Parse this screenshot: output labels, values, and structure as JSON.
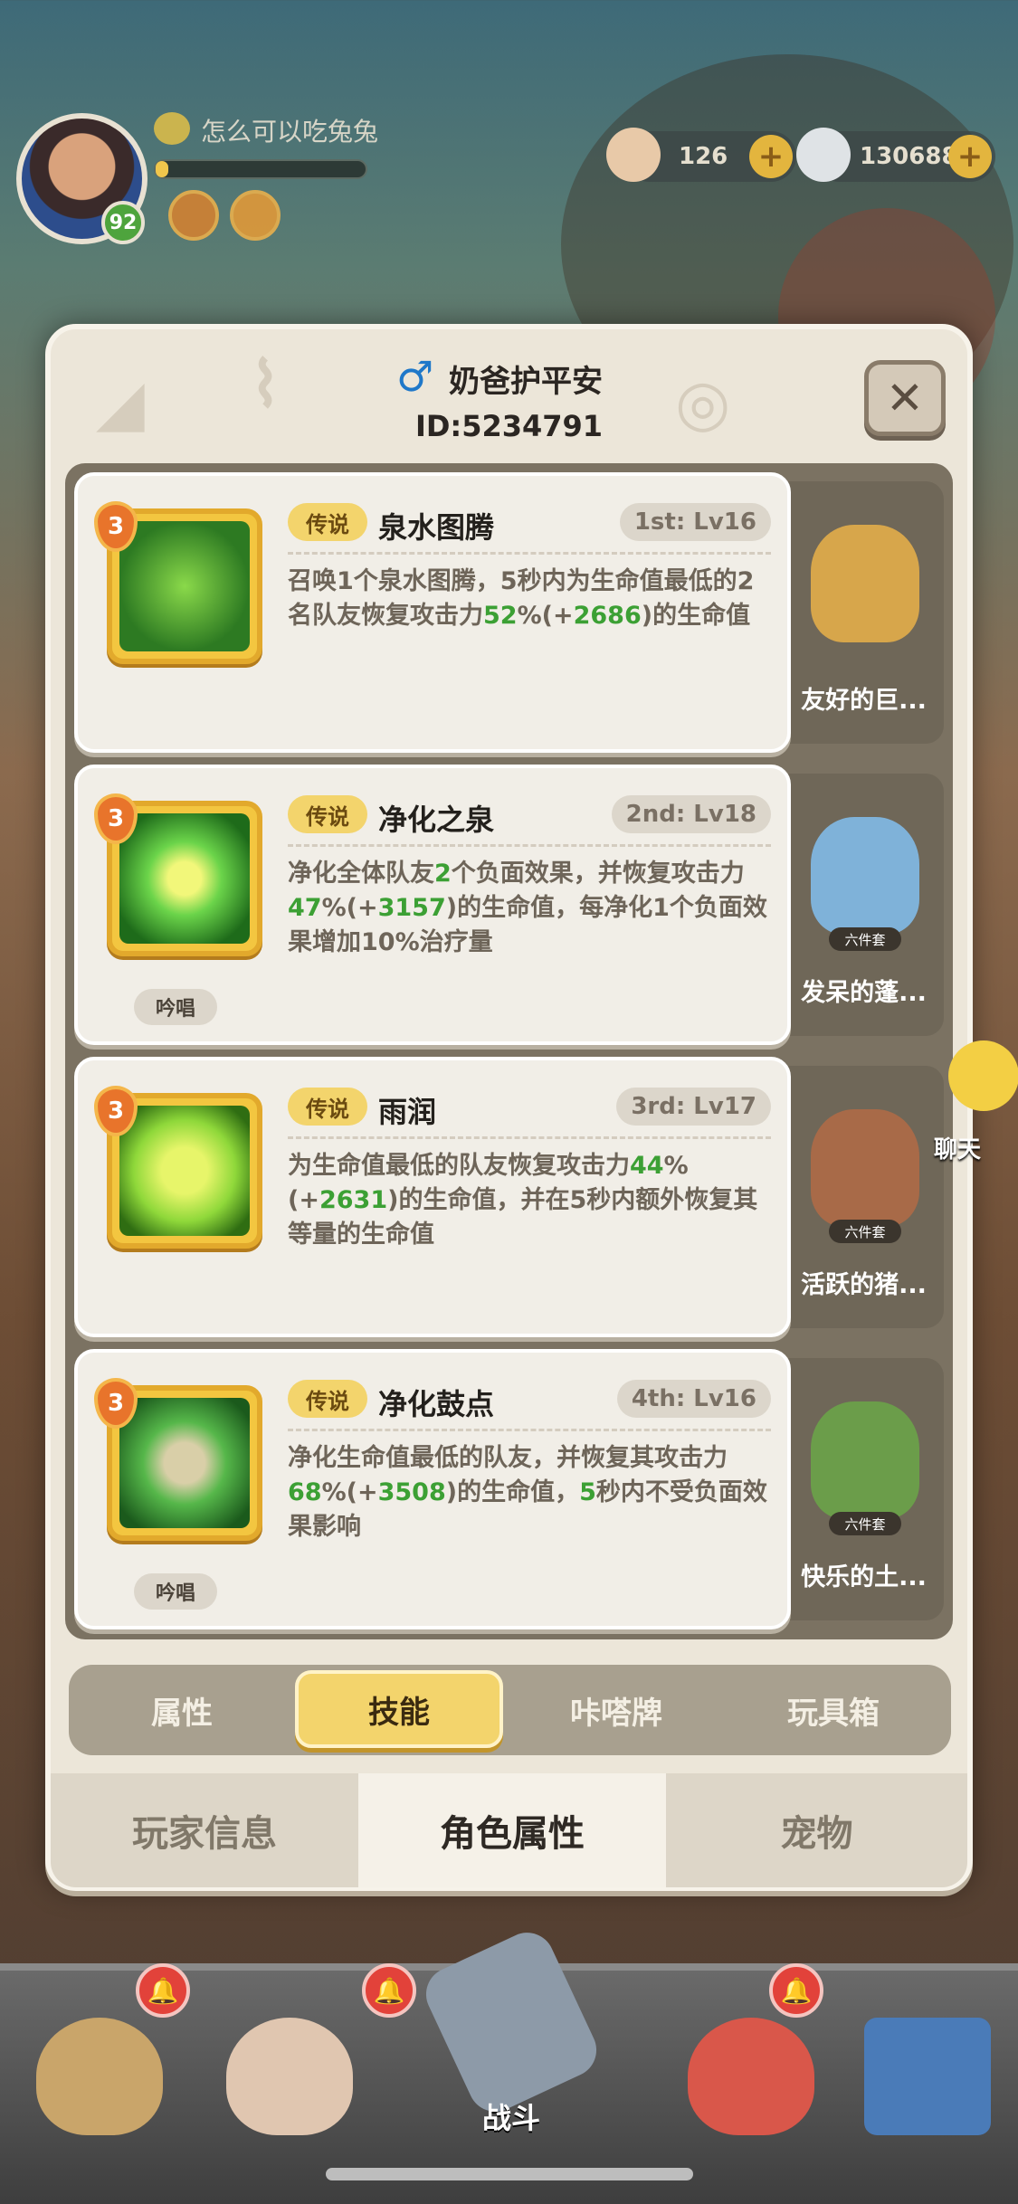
{
  "player": {
    "name": "怎么可以吃兔兔",
    "level": "92",
    "xp_fraction": 0.06
  },
  "currencies": [
    {
      "value": "126",
      "icon": "shell-coin-icon"
    },
    {
      "value": "130688",
      "icon": "pearl-icon"
    }
  ],
  "modal": {
    "gender_icon": "male-icon",
    "gender_glyph": "♂",
    "name": "奶爸护平安",
    "id": "ID:5234791",
    "close_glyph": "✕"
  },
  "skills": [
    {
      "rank": "3",
      "rarity": "传说",
      "name": "泉水图腾",
      "level": "1st: Lv16",
      "desc_parts": [
        "召唤1个泉水图腾，5秒内为生命值最低的2名队友恢复攻击力",
        "52",
        "%(+",
        "2686",
        ")的生命值"
      ],
      "chant": "",
      "set_tag": "",
      "set_name": "友好的巨..."
    },
    {
      "rank": "3",
      "rarity": "传说",
      "name": "净化之泉",
      "level": "2nd: Lv18",
      "desc_parts": [
        "净化全体队友",
        "2",
        "个负面效果，并恢复攻击力",
        "47",
        "%(+",
        "3157",
        ")的生命值，每净化1个负面效果增加10%治疗量"
      ],
      "chant": "吟唱",
      "set_tag": "六件套",
      "set_name": "发呆的蓬..."
    },
    {
      "rank": "3",
      "rarity": "传说",
      "name": "雨润",
      "level": "3rd: Lv17",
      "desc_parts": [
        "为生命值最低的队友恢复攻击力",
        "44",
        "%(+",
        "2631",
        ")的生命值，并在5秒内额外恢复其等量的生命值"
      ],
      "chant": "",
      "set_tag": "六件套",
      "set_name": "活跃的猪..."
    },
    {
      "rank": "3",
      "rarity": "传说",
      "name": "净化鼓点",
      "level": "4th: Lv16",
      "desc_parts": [
        "净化生命值最低的队友，并恢复其攻击力",
        "68",
        "%(+",
        "3508",
        ")的生命值，",
        "5",
        "秒内不受负面效果影响"
      ],
      "chant": "吟唱",
      "set_tag": "六件套",
      "set_name": "快乐的土..."
    }
  ],
  "sub_tabs": [
    "属性",
    "技能",
    "咔嗒牌",
    "玩具箱"
  ],
  "sub_tab_active": 1,
  "main_tabs": [
    "玩家信息",
    "角色属性",
    "宠物"
  ],
  "main_tab_active": 1,
  "chat": {
    "label": "聊天"
  },
  "bottom_nav": {
    "battle_label": "战斗",
    "bell_glyph": "🔔"
  },
  "colors": {
    "legend_tag": "#f3d46c",
    "highlight_green": "#3ca034",
    "active_tab": "#f3d46c"
  }
}
